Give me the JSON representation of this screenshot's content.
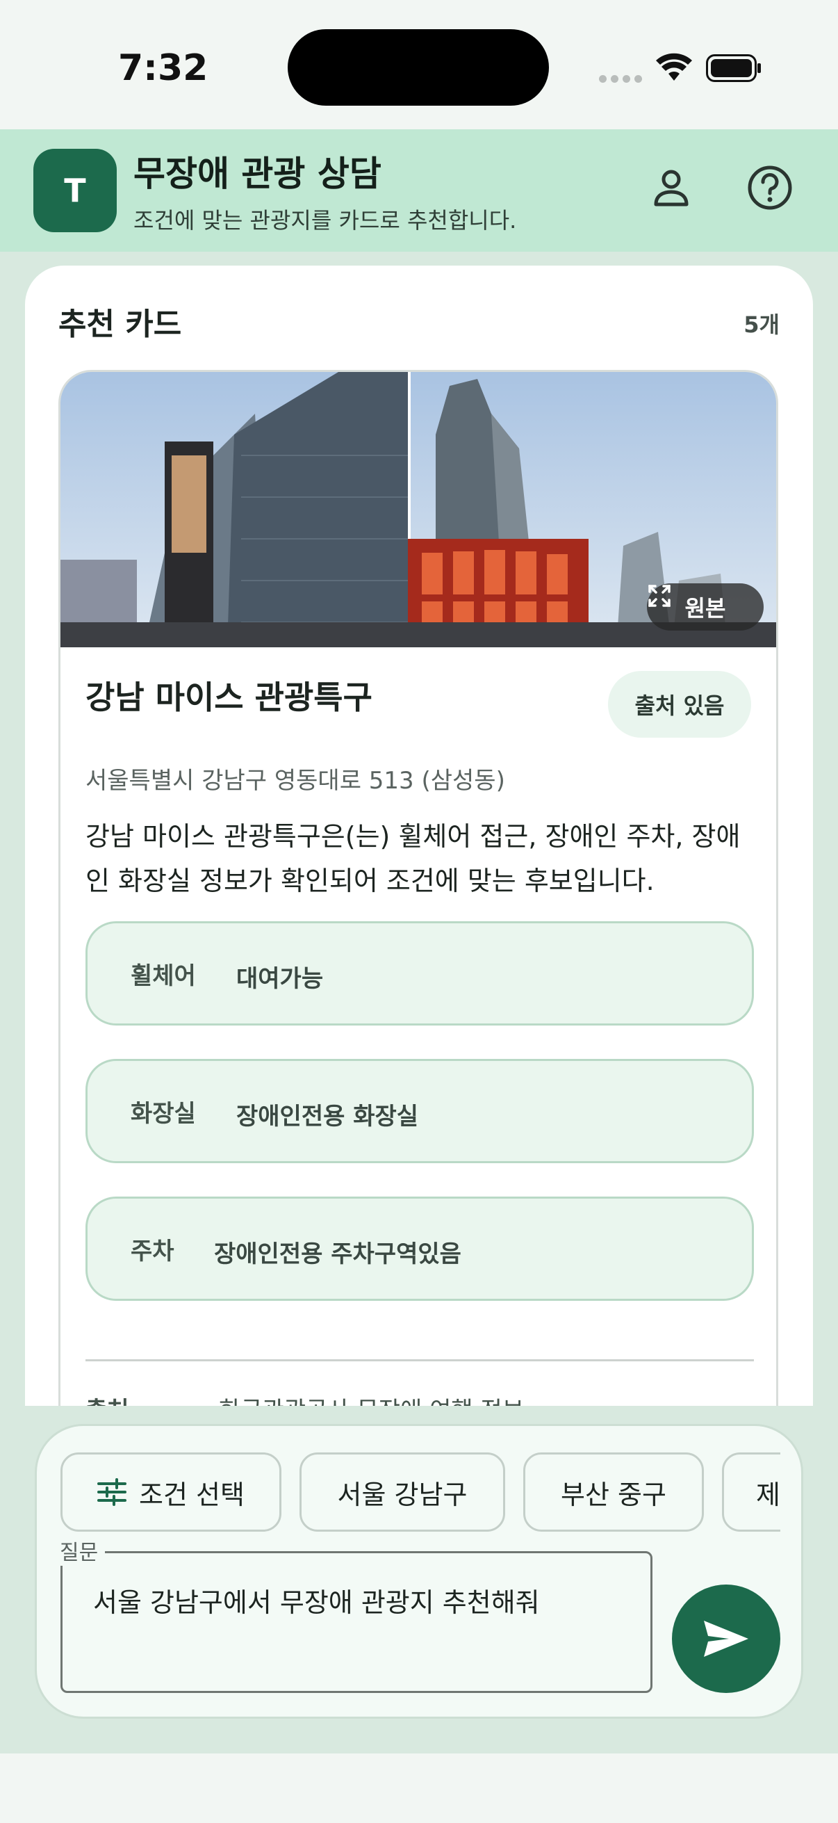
{
  "status_bar": {
    "time": "7:32"
  },
  "header": {
    "logo_letter": "T",
    "title": "무장애 관광 상담",
    "subtitle": "조건에 맞는 관광지를 카드로 추천합니다.",
    "icons": [
      "person-icon",
      "help-icon"
    ]
  },
  "panel": {
    "title": "추천 카드",
    "count": "5개"
  },
  "card": {
    "original_label": "원본",
    "name": "강남 마이스 관광특구",
    "source_badge": "출처 있음",
    "address": "서울특별시 강남구 영동대로 513 (삼성동)",
    "description": "강남 마이스 관광특구은(는) 휠체어 접근, 장애인 주차, 장애인 화장실 정보가 확인되어 조건에 맞는 후보입니다.",
    "facilities": [
      {
        "key": "휠체어",
        "value": "대여가능"
      },
      {
        "key": "화장실",
        "value": "장애인전용 화장실"
      },
      {
        "key": "주차",
        "value": "장애인전용 주차구역있음"
      }
    ],
    "footer_key": "출처",
    "footer_value": "한국관광공사 무장애 여행 정보"
  },
  "input": {
    "chips": [
      {
        "label": "조건 선택",
        "icon": "sliders-icon"
      },
      {
        "label": "서울 강남구"
      },
      {
        "label": "부산 중구"
      },
      {
        "label": "제"
      }
    ],
    "question_label": "질문",
    "question_value": "서울 강남구에서 무장애 관광지 추천해줘",
    "send_icon": "send-icon"
  },
  "colors": {
    "accent": "#1c6a4c",
    "header_bg": "#c0e8d3",
    "chip_bg": "#eaf6ee"
  }
}
